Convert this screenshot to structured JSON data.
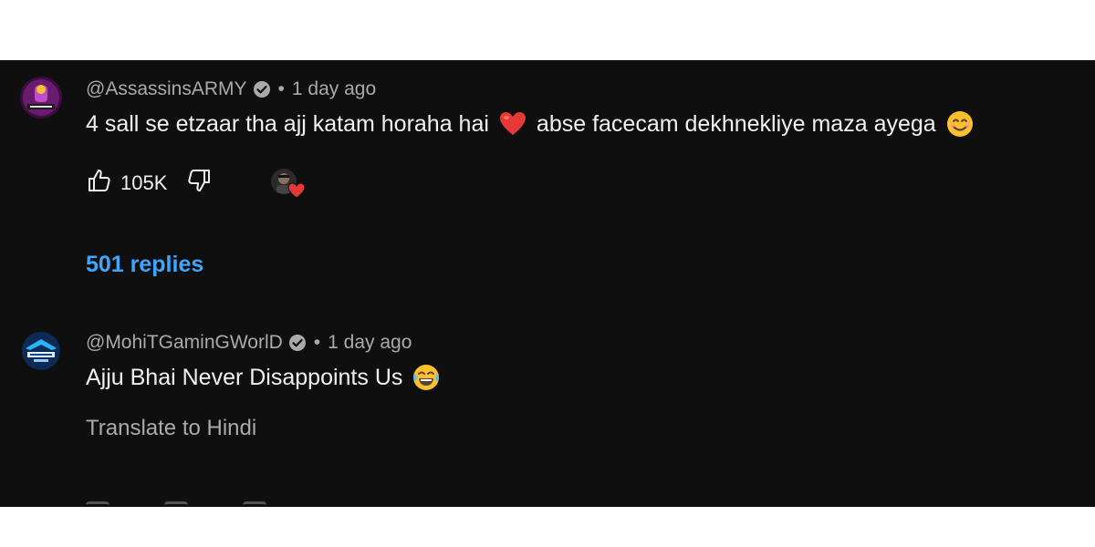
{
  "comments": [
    {
      "handle": "@AssassinsARMY",
      "time": "1 day ago",
      "separator": "•",
      "text_part1": "4 sall se etzaar tha ajj katam horaha hai",
      "text_part2": "abse facecam dekhnekliye maza ayega",
      "likes": "105K",
      "replies_label": "501 replies",
      "avatar_color": "#6a1b6e"
    },
    {
      "handle": "@MohiTGaminGWorlD",
      "time": "1 day ago",
      "separator": "•",
      "text": "Ajju Bhai Never Disappoints Us",
      "translate_label": "Translate to Hindi",
      "avatar_color": "#0d2a55"
    }
  ],
  "colors": {
    "background": "#0f0f0f",
    "text": "#f1f1f1",
    "secondary": "#aaaaaa",
    "link": "#3ea6ff",
    "heart": "#e53935"
  },
  "icons": [
    "verified-icon",
    "heart-emoji",
    "smile-emoji",
    "tears-of-joy-emoji",
    "thumbs-up-icon",
    "thumbs-down-icon",
    "creator-heart-icon"
  ]
}
